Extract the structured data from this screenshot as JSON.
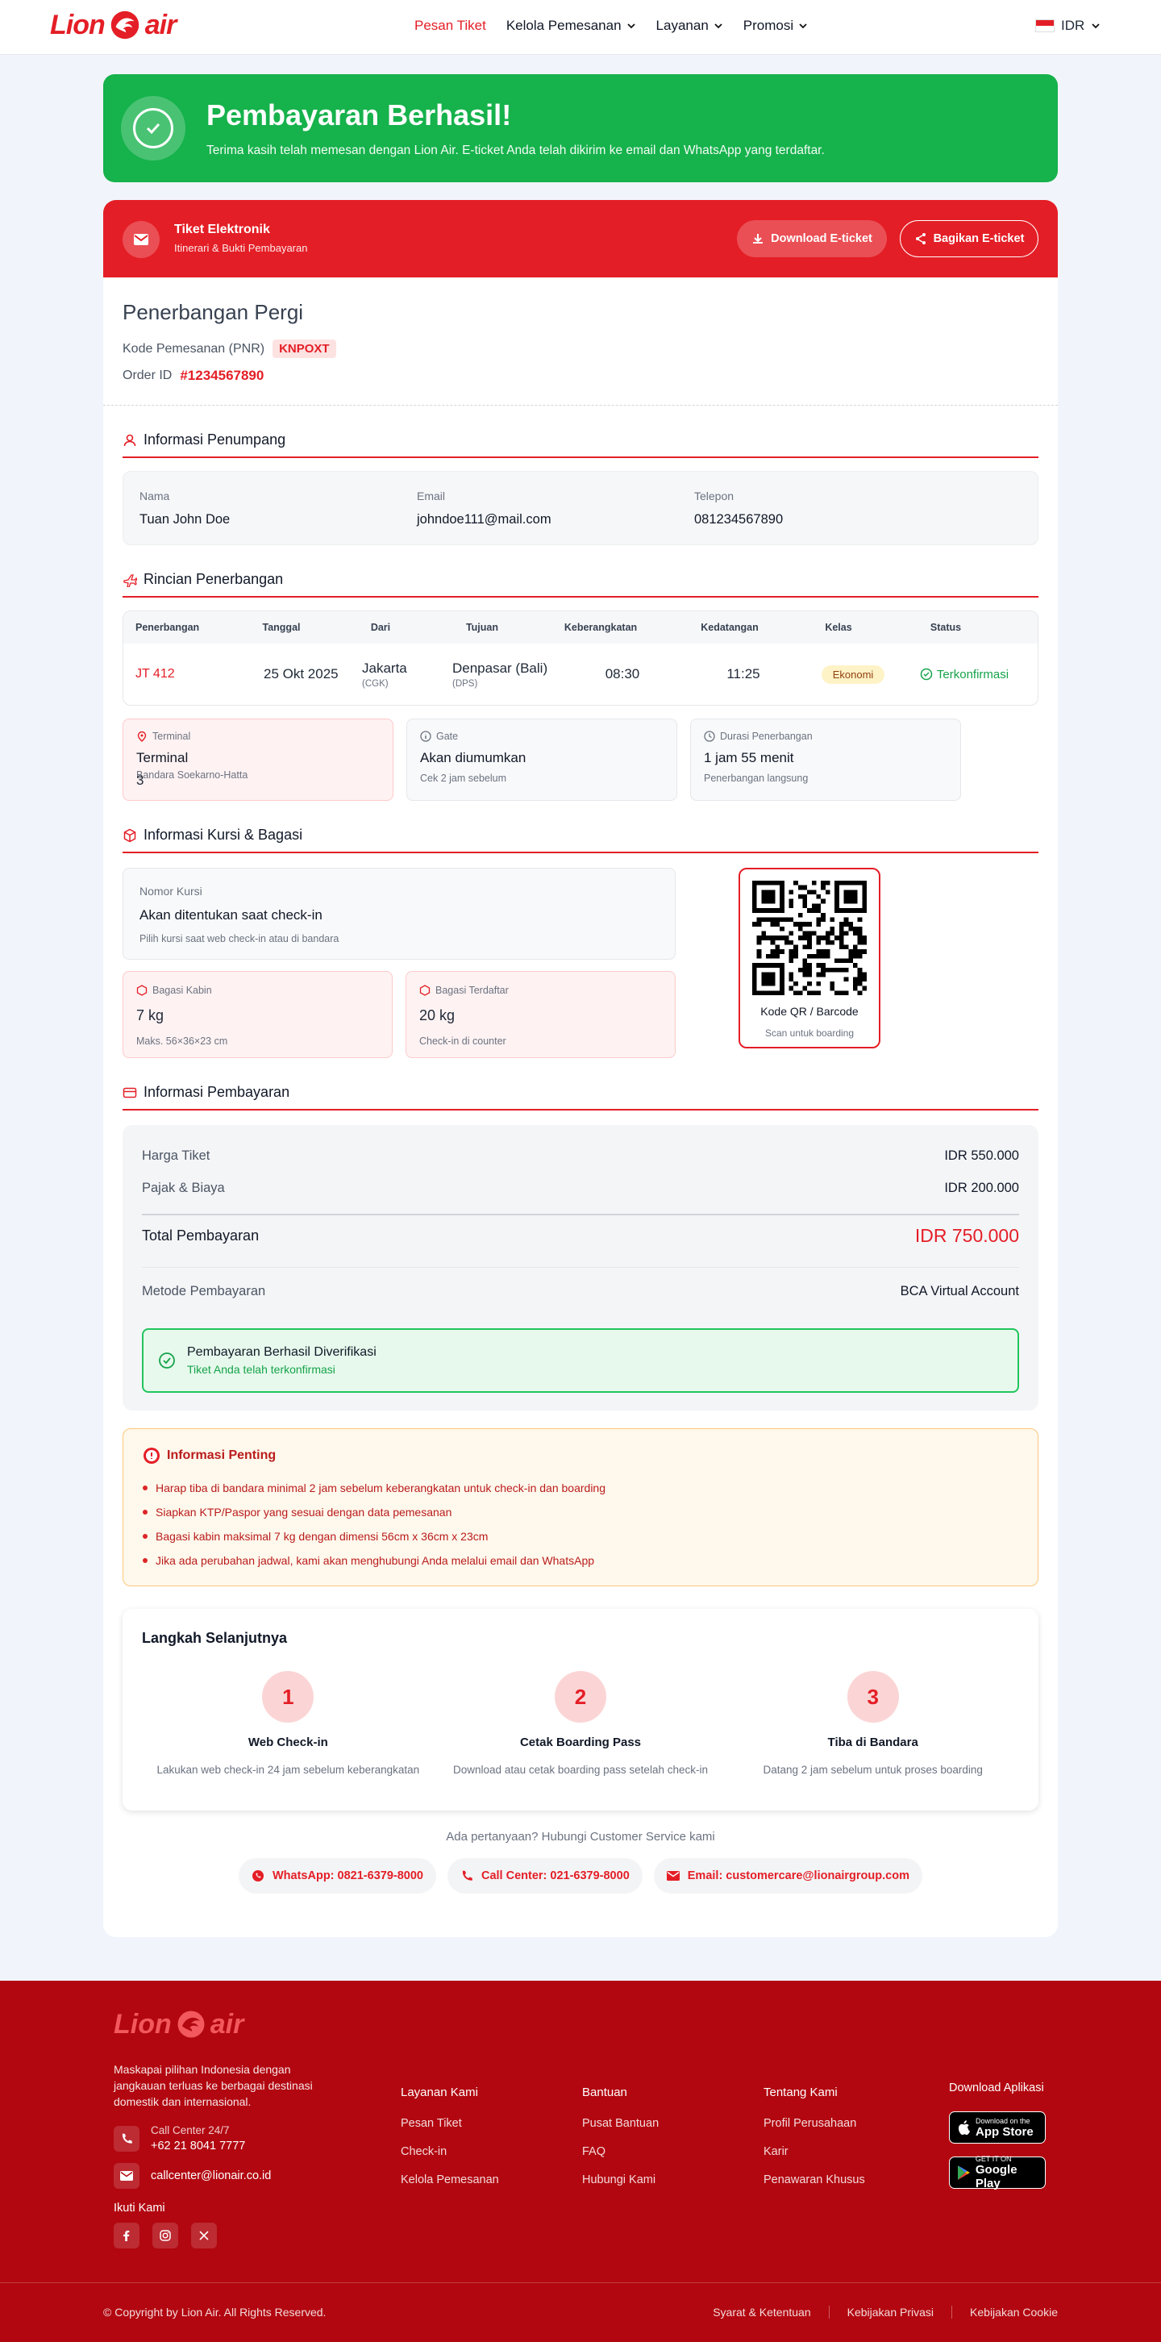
{
  "header": {
    "brand_a": "Lion",
    "brand_b": "air",
    "nav": [
      "Pesan Tiket",
      "Kelola Pemesanan",
      "Layanan",
      "Promosi"
    ],
    "currency": "IDR"
  },
  "success": {
    "title": "Pembayaran Berhasil!",
    "subtitle": "Terima kasih telah memesan dengan Lion Air. E-ticket Anda telah dikirim ke email dan WhatsApp yang terdaftar."
  },
  "ticket": {
    "title": "Tiket Elektronik",
    "subtitle": "Itinerari & Bukti Pembayaran",
    "download": "Download E-ticket",
    "share": "Bagikan E-ticket"
  },
  "trip": {
    "title": "Penerbangan Pergi",
    "pnr_label": "Kode Pemesanan (PNR)",
    "pnr": "KNPOXT",
    "order_label": "Order ID",
    "order_id": "#1234567890"
  },
  "passenger": {
    "section": "Informasi Penumpang",
    "fields": [
      {
        "label": "Nama",
        "value": "Tuan John Doe"
      },
      {
        "label": "Email",
        "value": "johndoe111@mail.com"
      },
      {
        "label": "Telepon",
        "value": "081234567890"
      }
    ]
  },
  "flight": {
    "section": "Rincian Penerbangan",
    "headers": [
      "Penerbangan",
      "Tanggal",
      "Dari",
      "Tujuan",
      "Keberangkatan",
      "Kedatangan",
      "Kelas",
      "Status"
    ],
    "row": {
      "flight": "JT 412",
      "date": "25 Okt 2025",
      "from": "Jakarta",
      "from_code": "(CGK)",
      "to": "Denpasar (Bali)",
      "to_code": "(DPS)",
      "depart": "08:30",
      "arrive": "11:25",
      "class": "Ekonomi",
      "status": "Terkonfirmasi"
    },
    "terminal": {
      "label": "Terminal",
      "value": "Terminal",
      "value2": "3",
      "sub": "Bandara Soekarno-Hatta"
    },
    "gate": {
      "label": "Gate",
      "value": "Akan diumumkan",
      "sub": "Cek 2 jam sebelum"
    },
    "duration": {
      "label": "Durasi Penerbangan",
      "value": "1 jam 55 menit",
      "sub": "Penerbangan langsung"
    }
  },
  "seat": {
    "section": "Informasi Kursi & Bagasi",
    "label": "Nomor Kursi",
    "value": "Akan ditentukan saat check-in",
    "sub": "Pilih kursi saat web check-in atau di bandara",
    "cabin": {
      "label": "Bagasi Kabin",
      "value": "7 kg",
      "sub": "Maks. 56×36×23 cm"
    },
    "checked": {
      "label": "Bagasi Terdaftar",
      "value": "20 kg",
      "sub": "Check-in di counter"
    },
    "qr_title": "Kode QR / Barcode",
    "qr_sub": "Scan untuk boarding"
  },
  "payment": {
    "section": "Informasi Pembayaran",
    "rows": [
      {
        "label": "Harga Tiket",
        "value": "IDR 550.000"
      },
      {
        "label": "Pajak & Biaya",
        "value": "IDR 200.000"
      }
    ],
    "total_label": "Total Pembayaran",
    "total": "IDR 750.000",
    "method_label": "Metode Pembayaran",
    "method": "BCA Virtual Account",
    "verified": "Pembayaran Berhasil Diverifikasi",
    "verified_sub": "Tiket Anda telah terkonfirmasi"
  },
  "important": {
    "title": "Informasi Penting",
    "items": [
      "Harap tiba di bandara minimal 2 jam sebelum keberangkatan untuk check-in dan boarding",
      "Siapkan KTP/Paspor yang sesuai dengan data pemesanan",
      "Bagasi kabin maksimal 7 kg dengan dimensi 56cm x 36cm x 23cm",
      "Jika ada perubahan jadwal, kami akan menghubungi Anda melalui email dan WhatsApp"
    ]
  },
  "steps": {
    "title": "Langkah Selanjutnya",
    "items": [
      {
        "n": "1",
        "title": "Web Check-in",
        "desc": "Lakukan web check-in 24 jam sebelum keberangkatan"
      },
      {
        "n": "2",
        "title": "Cetak Boarding Pass",
        "desc": "Download atau cetak boarding pass setelah check-in"
      },
      {
        "n": "3",
        "title": "Tiba di Bandara",
        "desc": "Datang 2 jam sebelum untuk proses boarding"
      }
    ]
  },
  "contact": {
    "text": "Ada pertanyaan? Hubungi Customer Service kami",
    "whatsapp": "WhatsApp: 0821-6379-8000",
    "call": "Call Center: 021-6379-8000",
    "email": "Email: customercare@lionairgroup.com"
  },
  "footer": {
    "desc": "Maskapai pilihan Indonesia dengan jangkauan terluas ke berbagai destinasi domestik dan internasional.",
    "cc_label": "Call Center 24/7",
    "cc_phone": "+62 21 8041 7777",
    "email": "callcenter@lionair.co.id",
    "follow": "Ikuti Kami",
    "col1": {
      "title": "Layanan Kami",
      "items": [
        "Pesan Tiket",
        "Check-in",
        "Kelola Pemesanan"
      ]
    },
    "col2": {
      "title": "Bantuan",
      "items": [
        "Pusat Bantuan",
        "FAQ",
        "Hubungi Kami"
      ]
    },
    "col3": {
      "title": "Tentang Kami",
      "items": [
        "Profil Perusahaan",
        "Karir",
        "Penawaran Khusus"
      ]
    },
    "download": "Download Aplikasi",
    "appstore_sm": "Download on the",
    "appstore_lg": "App Store",
    "gplay_sm": "GET IT ON",
    "gplay_lg": "Google Play",
    "copyright": "© Copyright by Lion Air. All Rights Reserved.",
    "links": [
      "Syarat & Ketentuan",
      "Kebijakan Privasi",
      "Kebijakan Cookie"
    ]
  }
}
